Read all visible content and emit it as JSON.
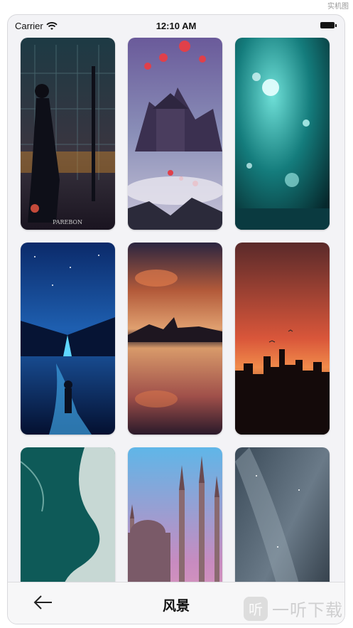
{
  "corner_mark": "实机图",
  "status_bar": {
    "carrier": "Carrier",
    "time": "12:10 AM",
    "wifi_icon": "wifi-icon",
    "battery_icon": "battery-icon"
  },
  "wallpapers": [
    {
      "theme": "night-window-silhouette",
      "caption": "PAREBON"
    },
    {
      "theme": "floating-lantern-castle"
    },
    {
      "theme": "teal-clouds"
    },
    {
      "theme": "starry-river-boy"
    },
    {
      "theme": "sunset-lake-reflection"
    },
    {
      "theme": "orange-city-skyline"
    },
    {
      "theme": "ocean-wave-aerial"
    },
    {
      "theme": "pink-sky-mosque"
    },
    {
      "theme": "milky-way"
    }
  ],
  "nav": {
    "title": "风景",
    "back_icon": "back-arrow-icon"
  },
  "watermark": {
    "logo_glyph": "听",
    "text": "一听下载"
  },
  "colors": {
    "background": "#f3f3f6",
    "nav_background": "#f7f7f8"
  }
}
